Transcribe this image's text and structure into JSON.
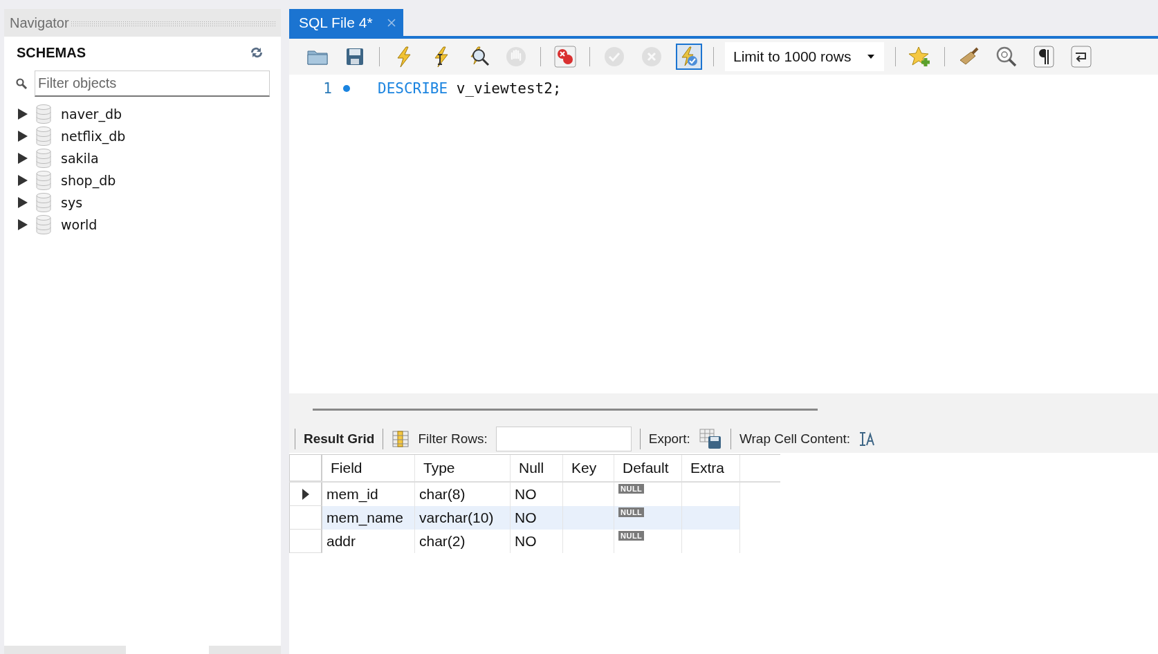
{
  "navigator": {
    "title": "Navigator",
    "section_title": "SCHEMAS",
    "filter": {
      "placeholder": "Filter objects"
    },
    "schemas": [
      {
        "name": "naver_db",
        "expanded": false
      },
      {
        "name": "netflix_db",
        "expanded": false
      },
      {
        "name": "sakila",
        "expanded": false
      },
      {
        "name": "shop_db",
        "expanded": false
      },
      {
        "name": "sys",
        "expanded": false
      },
      {
        "name": "world",
        "expanded": false
      }
    ]
  },
  "tabs": [
    {
      "label": "SQL File 4*",
      "selected": true
    }
  ],
  "toolbar": [
    [
      {
        "kind": "open",
        "disabled": false,
        "on": false
      },
      {
        "kind": "save",
        "disabled": false,
        "on": false
      }
    ],
    [
      {
        "kind": "execute",
        "disabled": false,
        "on": false
      },
      {
        "kind": "execute_current",
        "disabled": false,
        "on": false
      },
      {
        "kind": "explain",
        "disabled": false,
        "on": false
      },
      {
        "kind": "stop",
        "disabled": true,
        "on": false
      }
    ],
    [
      {
        "kind": "stop_on_error",
        "disabled": false,
        "on": false
      }
    ],
    [
      {
        "kind": "commit",
        "disabled": true,
        "on": false
      },
      {
        "kind": "rollback",
        "disabled": true,
        "on": false
      },
      {
        "kind": "autocommit",
        "disabled": false,
        "on": true
      }
    ],
    [
      {
        "kind": "limit",
        "label": "Limit to 1000 rows",
        "disabled": false,
        "on": false
      }
    ],
    [
      {
        "kind": "snippet",
        "disabled": false,
        "on": false
      }
    ],
    [
      {
        "kind": "beautify",
        "disabled": false,
        "on": false
      },
      {
        "kind": "find",
        "disabled": false,
        "on": false
      },
      {
        "kind": "invisible",
        "disabled": false,
        "on": false
      },
      {
        "kind": "wrap",
        "disabled": false,
        "on": false
      }
    ]
  ],
  "editor": {
    "lines": [
      {
        "number": "1",
        "keyword": "DESCRIBE",
        "rest": "v_viewtest2;"
      }
    ]
  },
  "result_toolbar": {
    "result_grid": "Result Grid",
    "filter_label": "Filter Rows:",
    "export_label": "Export:",
    "wrap_label": "Wrap Cell Content:"
  },
  "result": {
    "columns": [
      "Field",
      "Type",
      "Null",
      "Key",
      "Default",
      "Extra"
    ],
    "rows": [
      {
        "cells": [
          "mem_id",
          "char(8)",
          "NO",
          "",
          "NULL",
          ""
        ],
        "current": true,
        "selected": false
      },
      {
        "cells": [
          "mem_name",
          "varchar(10)",
          "NO",
          "",
          "NULL",
          ""
        ],
        "current": false,
        "selected": true
      },
      {
        "cells": [
          "addr",
          "char(2)",
          "NO",
          "",
          "NULL",
          ""
        ],
        "current": false,
        "selected": false
      }
    ]
  }
}
